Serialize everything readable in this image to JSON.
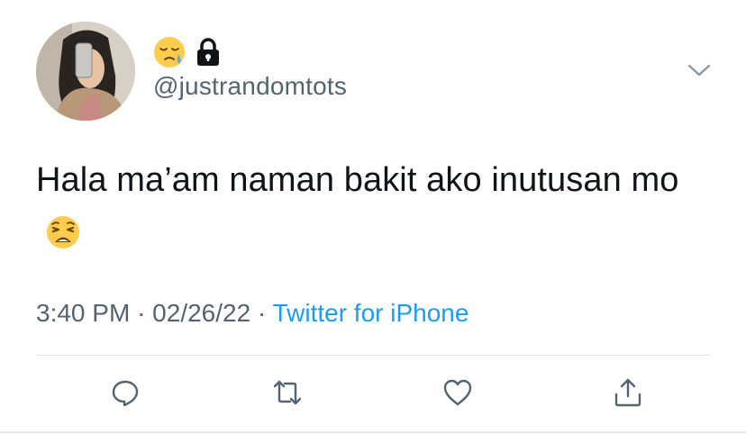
{
  "tweet": {
    "handle": "@justrandomtots",
    "name_emoji": "sleepy-face-emoji",
    "protected_icon": "lock-icon",
    "text": "Hala ma’am naman bakit ako inutusan mo",
    "trailing_emoji": "weary-face-emoji",
    "time": "3:40 PM",
    "separator": "·",
    "date": "02/26/22",
    "source": "Twitter for iPhone"
  },
  "actions": [
    {
      "name": "reply",
      "icon": "reply-icon"
    },
    {
      "name": "retweet",
      "icon": "retweet-icon"
    },
    {
      "name": "like",
      "icon": "heart-icon"
    },
    {
      "name": "share",
      "icon": "share-icon"
    }
  ],
  "menu_icon": "chevron-down-icon",
  "colors": {
    "text": "#0f1419",
    "secondary": "#536471",
    "link": "#1d9bf0",
    "divider": "#e1e4e8"
  }
}
